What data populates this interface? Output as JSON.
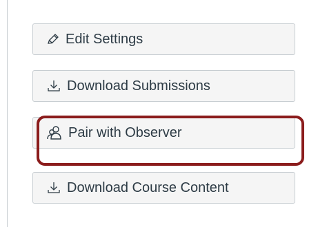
{
  "sidebar_buttons": {
    "edit_settings": {
      "label": "Edit Settings",
      "icon": "pencil-icon"
    },
    "download_submissions": {
      "label": "Download Submissions",
      "icon": "download-icon"
    },
    "pair_with_observer": {
      "label": "Pair with Observer",
      "icon": "people-icon",
      "highlighted": true
    },
    "download_course_content": {
      "label": "Download Course Content",
      "icon": "download-icon"
    }
  },
  "colors": {
    "button_bg": "#f5f5f5",
    "button_text": "#2d3b45",
    "button_border": "#c7cdd1",
    "highlight": "#8b1c1c"
  }
}
